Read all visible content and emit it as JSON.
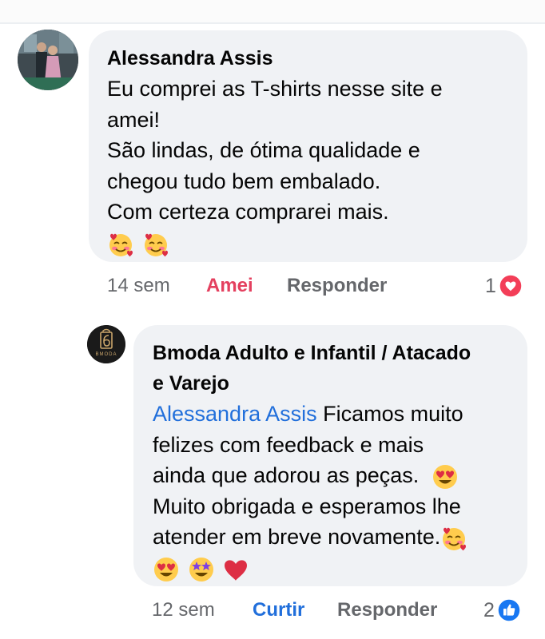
{
  "comment": {
    "author": "Alessandra Assis",
    "lines": [
      "Eu comprei as T-shirts nesse site e",
      "amei!",
      "São lindas, de ótima qualidade e",
      "chegou tudo bem embalado.",
      "Com certeza comprarei mais."
    ],
    "emojis": [
      "smiling-face-with-hearts",
      "smiling-face-with-hearts"
    ],
    "time": "14 sem",
    "reaction_label": "Amei",
    "reply_label": "Responder",
    "reaction_count": "1",
    "reaction_icon": "love-heart-icon",
    "colors": {
      "reaction_active": "#e4405f",
      "heart_badge": "#f33e58"
    }
  },
  "reply": {
    "author_line1": "Bmoda Adulto e Infantil / Atacado",
    "author_line2": "e Varejo",
    "avatar_logo_text": "BMODA",
    "mention": "Alessandra Assis",
    "lines": [
      " Ficamos muito",
      "felizes com feedback e mais",
      "ainda que adorou as peças.",
      "Muito obrigada e esperamos lhe",
      "atender em breve novamente."
    ],
    "emojis_inline": [
      "heart-eyes"
    ],
    "emojis_end": [
      "smiling-face-with-hearts"
    ],
    "emojis_row": [
      "heart-eyes",
      "star-struck",
      "red-heart"
    ],
    "time": "12 sem",
    "like_label": "Curtir",
    "reply_label": "Responder",
    "reaction_count": "2",
    "reaction_icon": "like-thumb-icon",
    "colors": {
      "mention": "#216fdb",
      "like_badge": "#1877f2"
    }
  }
}
